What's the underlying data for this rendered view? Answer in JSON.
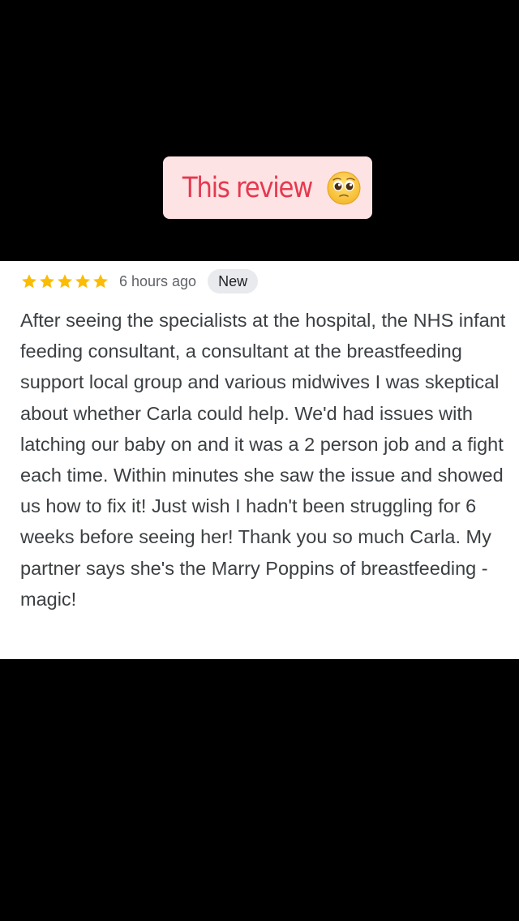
{
  "caption": {
    "text": "This review",
    "emoji": "pleading-face"
  },
  "review": {
    "rating": 5,
    "rating_max": 5,
    "time_ago": "6 hours ago",
    "badge": "New",
    "text": "After seeing the specialists at the hospital, the NHS infant feeding consultant, a consultant at the breastfeeding support local group and various midwives I was skeptical about whether Carla could help. We'd had issues with latching our baby on and it was a 2 person job and a fight each time. Within minutes she saw the issue and showed us how to fix it! Just wish I hadn't been struggling for 6 weeks before seeing her! Thank you so much Carla. My partner says she's the Marry Poppins of breastfeeding - magic!"
  },
  "colors": {
    "star": "#fbbc04",
    "caption_text": "#e53950",
    "caption_bg": "#fde3e3",
    "background": "#000000"
  }
}
